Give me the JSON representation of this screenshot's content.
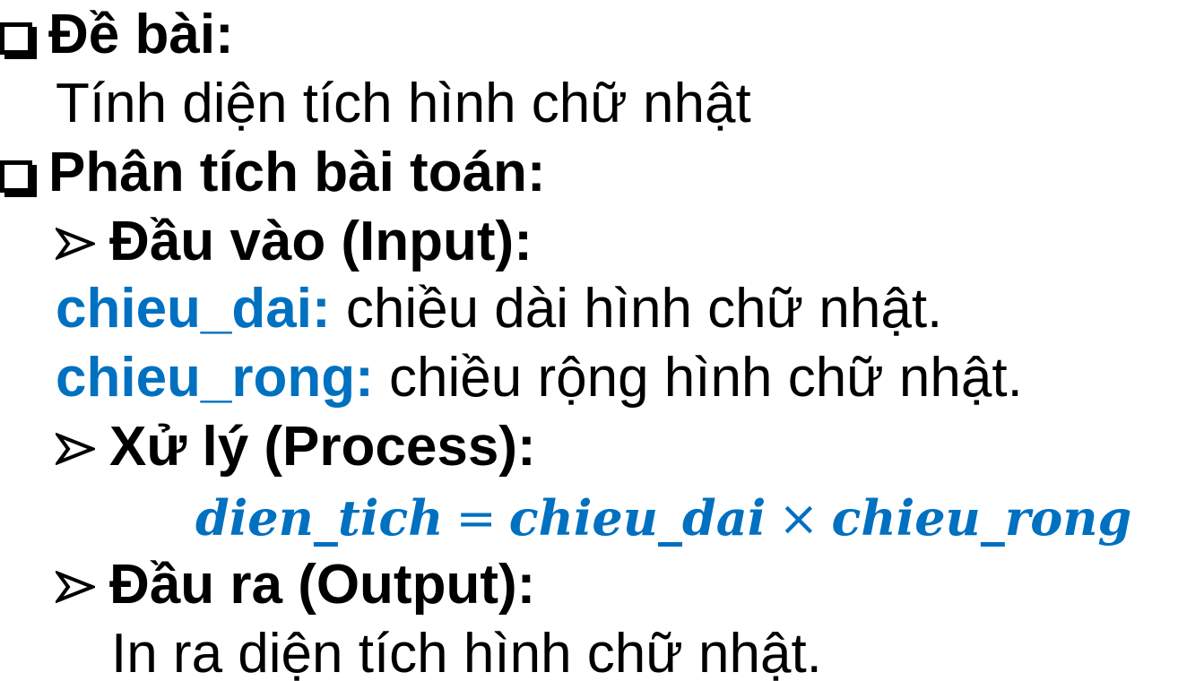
{
  "problem": {
    "heading": "Đề bài:",
    "statement": "Tính diện tích hình chữ nhật"
  },
  "analysis": {
    "heading": "Phân tích bài toán:",
    "input": {
      "heading": "Đầu vào (Input):",
      "vars": [
        {
          "name": "chieu_dai:",
          "desc": " chiều dài hình chữ nhật."
        },
        {
          "name": "chieu_rong:",
          "desc": " chiều rộng hình chữ nhật."
        }
      ]
    },
    "process": {
      "heading": "Xử lý (Process):",
      "formula": {
        "lhs": "dien_tich",
        "eq": "=",
        "a": "chieu_dai",
        "times": "×",
        "b": "chieu_rong"
      }
    },
    "output": {
      "heading": "Đầu ra (Output):",
      "text": "In ra diện tích hình chữ nhật."
    }
  },
  "colors": {
    "accent": "#0070c0",
    "text": "#000000"
  },
  "icons": {
    "section_bullet": "checkbox-square-icon",
    "sub_bullet": "arrowhead-icon"
  }
}
